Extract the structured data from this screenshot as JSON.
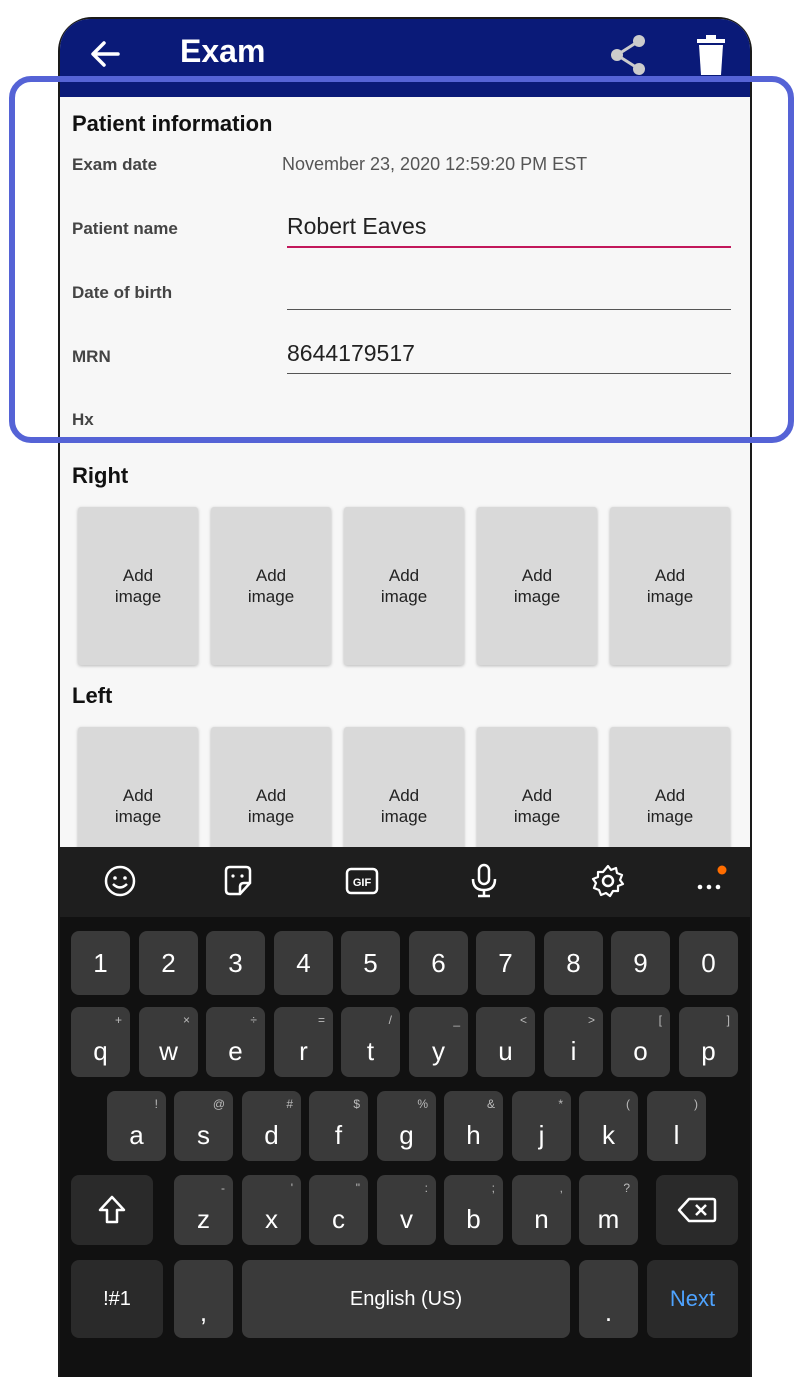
{
  "appbar": {
    "title": "Exam",
    "back_icon": "arrow-left-icon",
    "share_icon": "share-icon",
    "trash_icon": "trash-icon"
  },
  "patient": {
    "section_title": "Patient information",
    "exam_date_label": "Exam date",
    "exam_date_value": "November 23, 2020 12:59:20 PM EST",
    "name_label": "Patient name",
    "name_value": "Robert Eaves",
    "dob_label": "Date of birth",
    "dob_value": "",
    "mrn_label": "MRN",
    "mrn_value": "8644179517",
    "hx_label": "Hx",
    "hx_value": ""
  },
  "right": {
    "title": "Right",
    "slots": [
      "Add\nimage",
      "Add\nimage",
      "Add\nimage",
      "Add\nimage",
      "Add\nimage"
    ]
  },
  "left": {
    "title": "Left",
    "slots": [
      "Add\nimage",
      "Add\nimage",
      "Add\nimage",
      "Add\nimage",
      "Add\nimage"
    ]
  },
  "keyboard": {
    "toolbar": [
      "emoji-icon",
      "sticker-icon",
      "gif-icon",
      "microphone-icon",
      "settings-icon",
      "more-icon"
    ],
    "gif_label": "GIF",
    "row_numbers": [
      "1",
      "2",
      "3",
      "4",
      "5",
      "6",
      "7",
      "8",
      "9",
      "0"
    ],
    "row1": [
      [
        "q",
        "+"
      ],
      [
        "w",
        "×"
      ],
      [
        "e",
        "÷"
      ],
      [
        "r",
        "="
      ],
      [
        "t",
        "/"
      ],
      [
        "y",
        "_"
      ],
      [
        "u",
        "<"
      ],
      [
        "i",
        ">"
      ],
      [
        "o",
        "["
      ],
      [
        "p",
        "]"
      ]
    ],
    "row2": [
      [
        "a",
        "!"
      ],
      [
        "s",
        "@"
      ],
      [
        "d",
        "#"
      ],
      [
        "f",
        "$"
      ],
      [
        "g",
        "%"
      ],
      [
        "h",
        "&"
      ],
      [
        "j",
        "*"
      ],
      [
        "k",
        "("
      ],
      [
        "l",
        ")"
      ]
    ],
    "row3": [
      [
        "z",
        "-"
      ],
      [
        "x",
        "'"
      ],
      [
        "c",
        "\""
      ],
      [
        "v",
        ":"
      ],
      [
        "b",
        ";"
      ],
      [
        "n",
        ","
      ],
      [
        "m",
        "?"
      ]
    ],
    "symbols_label": "!#1",
    "comma_label": ",",
    "space_label": "English (US)",
    "period_label": ".",
    "next_label": "Next",
    "accent_color": "#4ea3ff",
    "notification_dot_color": "#ff6d00"
  },
  "colors": {
    "appbar": "#0a1a78",
    "highlight": "#5563d6",
    "active_underline": "#c2185b"
  }
}
